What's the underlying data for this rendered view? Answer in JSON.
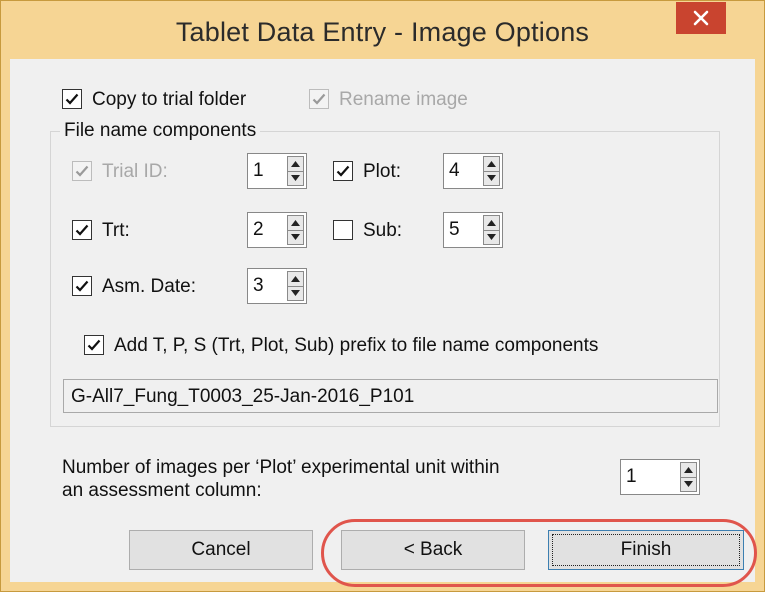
{
  "window": {
    "title": "Tablet Data Entry - Image Options",
    "close_label": "✕"
  },
  "options": {
    "copy_to_trial_folder": {
      "label": "Copy to trial folder",
      "checked": true
    },
    "rename_image": {
      "label": "Rename image",
      "checked": true,
      "enabled": false
    }
  },
  "file_name_components": {
    "group_label": "File name components",
    "trial_id": {
      "label": "Trial ID:",
      "checked": true,
      "enabled": false,
      "value": "1"
    },
    "plot": {
      "label": "Plot:",
      "checked": true,
      "value": "4"
    },
    "trt": {
      "label": "Trt:",
      "checked": true,
      "value": "2"
    },
    "sub": {
      "label": "Sub:",
      "checked": false,
      "value": "5"
    },
    "asm_date": {
      "label": "Asm. Date:",
      "checked": true,
      "value": "3"
    },
    "prefix_option": {
      "label": "Add T, P, S (Trt, Plot, Sub) prefix to file name components",
      "checked": true
    },
    "preview": "G-All7_Fung_T0003_25-Jan-2016_P101"
  },
  "images_per_plot": {
    "label_line1": "Number of images per ‘Plot’ experimental unit within",
    "label_line2": "an assessment column:",
    "value": "1"
  },
  "buttons": {
    "cancel": "Cancel",
    "back": "< Back",
    "finish": "Finish"
  },
  "colors": {
    "title_bar": "#f6d594",
    "close_button": "#c9442f",
    "highlight_oval": "#e0554c",
    "dialog_background": "#f0f0f0"
  }
}
